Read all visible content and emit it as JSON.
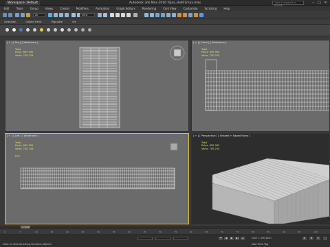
{
  "title_bar": {
    "workspace": "Workspace: Default",
    "title": "Autodesk 3ds Max 2016    Tojas_Hall01max.max",
    "search_placeholder": "Type a keyword or phrase",
    "controls": [
      "–",
      "□",
      "✕"
    ]
  },
  "menu": {
    "items": [
      "Edit",
      "Tools",
      "Group",
      "Views",
      "Create",
      "Modifiers",
      "Animation",
      "Graph Editors",
      "Rendering",
      "Civil View",
      "Customize",
      "Scripting",
      "Help"
    ]
  },
  "toolbar": {
    "selection_filter": "All",
    "view_dropdown": "View"
  },
  "ribbon": {
    "tabs": [
      "Selection",
      "Object Paint",
      "Populate"
    ]
  },
  "viewports": {
    "top": {
      "label": "[ + ] [ Top ] [ Wireframe ]"
    },
    "front": {
      "label": "[ + ] [ Front ] [ Wireframe ]"
    },
    "left": {
      "label": "[ + ] [ Left ] [ Wireframe ]",
      "fps_label": "FPS:"
    },
    "perspective": {
      "label": "[ + ] [ Perspective ] [ Shaded + Edged Faces ]"
    },
    "stats": {
      "total_label": "Total",
      "polys_label": "Polys:",
      "polys_value": "695 992",
      "verts_label": "Verts:",
      "verts_value": "700 234"
    }
  },
  "timeline": {
    "frame_counter": "0 / 100",
    "ticks": [
      "0",
      "5",
      "10",
      "15",
      "20",
      "25",
      "30",
      "35",
      "40",
      "45",
      "50",
      "55",
      "60",
      "65",
      "70",
      "75",
      "80",
      "85",
      "90",
      "95",
      "100"
    ]
  },
  "status": {
    "left_text": "Click or click-and-drag to select objects",
    "grid": "Grid = 100,0cm",
    "add_time_tag": "Add Time Tag"
  }
}
